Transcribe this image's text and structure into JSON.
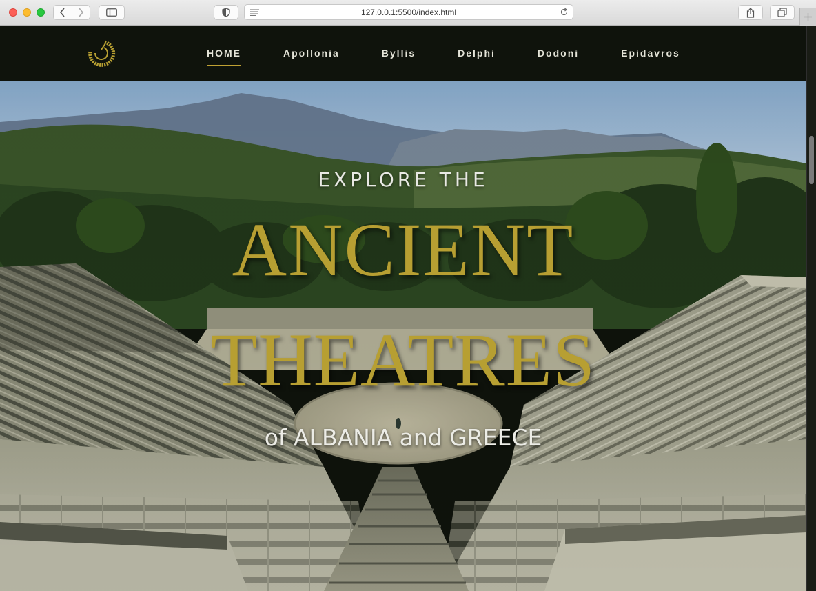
{
  "browser": {
    "url": "127.0.0.1:5500/index.html"
  },
  "site": {
    "nav": [
      {
        "label": "HOME",
        "active": true
      },
      {
        "label": "Apollonia",
        "active": false
      },
      {
        "label": "Byllis",
        "active": false
      },
      {
        "label": "Delphi",
        "active": false
      },
      {
        "label": "Dodoni",
        "active": false
      },
      {
        "label": "Epidavros",
        "active": false
      }
    ],
    "accent_color": "#bfa133",
    "header_color": "#0f130c"
  },
  "hero": {
    "eyebrow": "EXPLORE THE",
    "title_line_1": "ANCIENT",
    "title_line_2": "THEATRES",
    "subtitle": "of ALBANIA and GREECE"
  }
}
